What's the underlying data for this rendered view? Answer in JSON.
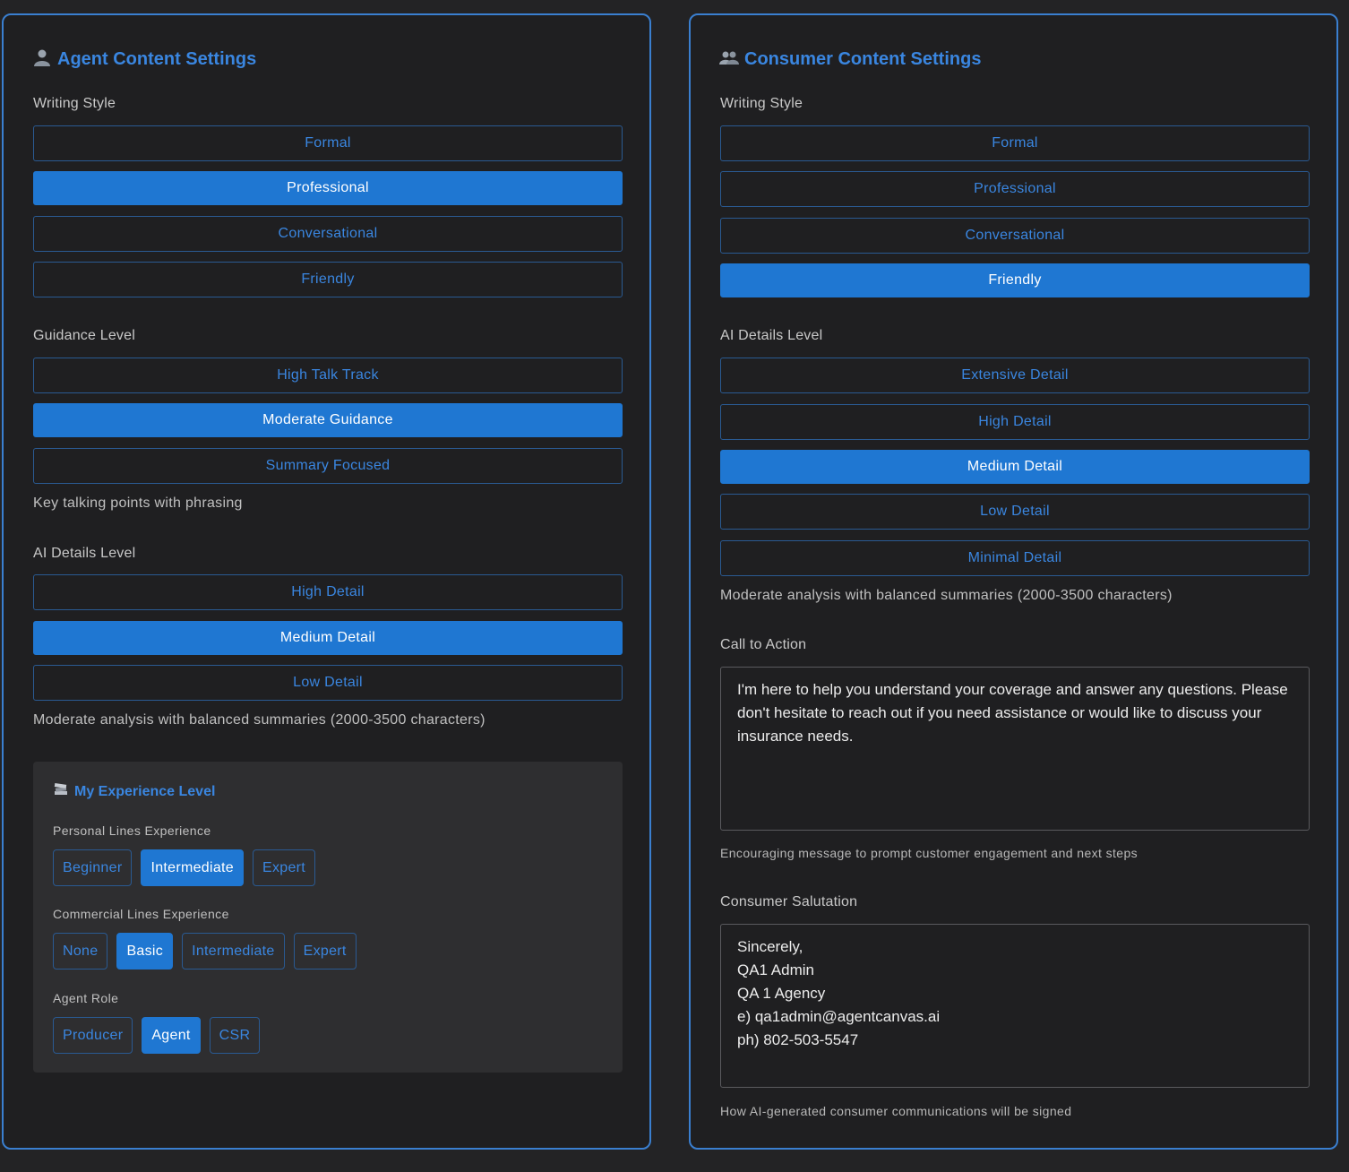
{
  "agent": {
    "title": "Agent Content Settings",
    "title_icon": "person-silhouette-icon",
    "writing_style": {
      "label": "Writing Style",
      "options": [
        "Formal",
        "Professional",
        "Conversational",
        "Friendly"
      ],
      "selected": "Professional"
    },
    "guidance_level": {
      "label": "Guidance Level",
      "options": [
        "High Talk Track",
        "Moderate Guidance",
        "Summary Focused"
      ],
      "selected": "Moderate Guidance",
      "helper": "Key talking points with phrasing"
    },
    "ai_details": {
      "label": "AI Details Level",
      "options": [
        "High Detail",
        "Medium Detail",
        "Low Detail"
      ],
      "selected": "Medium Detail",
      "helper": "Moderate analysis with balanced summaries (2000-3500 characters)"
    },
    "experience": {
      "title": "My Experience Level",
      "title_icon": "books-icon",
      "personal": {
        "label": "Personal Lines Experience",
        "options": [
          "Beginner",
          "Intermediate",
          "Expert"
        ],
        "selected": "Intermediate"
      },
      "commercial": {
        "label": "Commercial Lines Experience",
        "options": [
          "None",
          "Basic",
          "Intermediate",
          "Expert"
        ],
        "selected": "Basic"
      },
      "role": {
        "label": "Agent Role",
        "options": [
          "Producer",
          "Agent",
          "CSR"
        ],
        "selected": "Agent"
      }
    }
  },
  "consumer": {
    "title": "Consumer Content Settings",
    "title_icon": "people-silhouette-icon",
    "writing_style": {
      "label": "Writing Style",
      "options": [
        "Formal",
        "Professional",
        "Conversational",
        "Friendly"
      ],
      "selected": "Friendly"
    },
    "ai_details": {
      "label": "AI Details Level",
      "options": [
        "Extensive Detail",
        "High Detail",
        "Medium Detail",
        "Low Detail",
        "Minimal Detail"
      ],
      "selected": "Medium Detail",
      "helper": "Moderate analysis with balanced summaries (2000-3500 characters)"
    },
    "cta": {
      "label": "Call to Action",
      "value": "I'm here to help you understand your coverage and answer any questions. Please don't hesitate to reach out if you need assistance or would like to discuss your insurance needs.",
      "helper": "Encouraging message to prompt customer engagement and next steps"
    },
    "salutation": {
      "label": "Consumer Salutation",
      "value": "Sincerely,\nQA1 Admin\nQA 1 Agency\ne) qa1admin@agentcanvas.ai\nph) 802-503-5547",
      "helper": "How AI-generated consumer communications will be signed"
    }
  },
  "colors": {
    "accent": "#1f77d2",
    "accent_text": "#3a86e0",
    "panel_border": "#3a7fd0",
    "background": "#232325"
  }
}
